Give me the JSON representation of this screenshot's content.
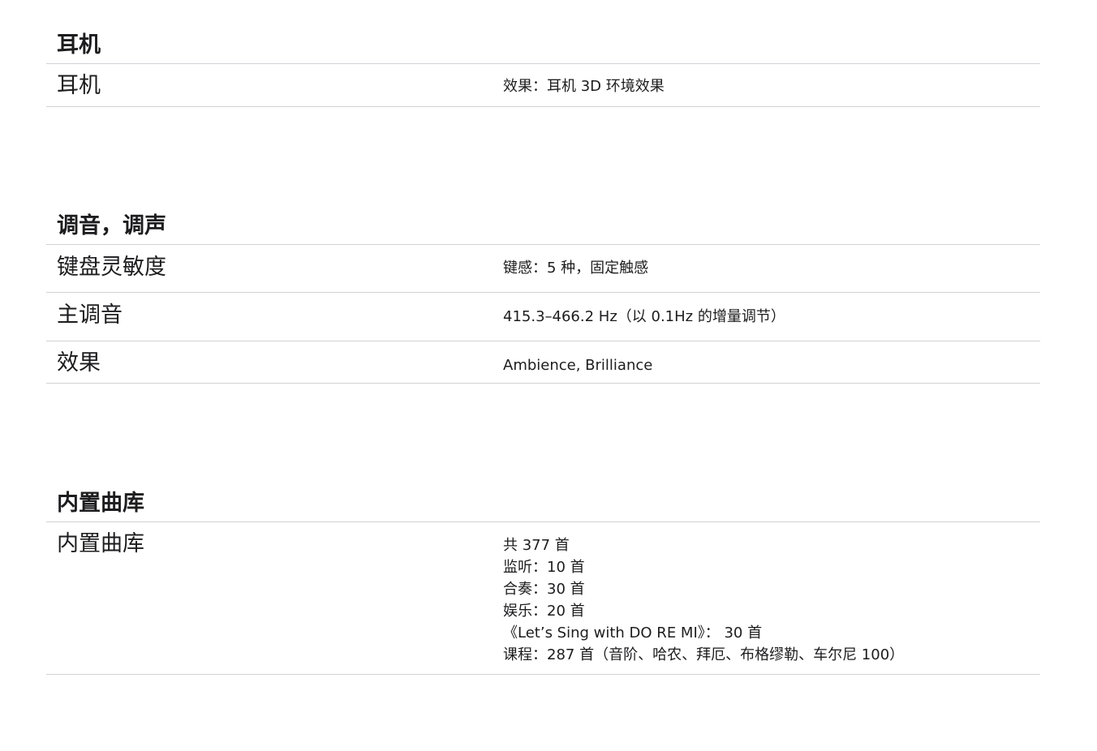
{
  "sections": [
    {
      "title": "耳机",
      "rows": [
        {
          "label": "耳机",
          "value_lines": [
            "效果：耳机 3D 环境效果"
          ]
        }
      ]
    },
    {
      "title": "调音，调声",
      "rows": [
        {
          "label": "键盘灵敏度",
          "value_lines": [
            "键感：5 种，固定触感"
          ]
        },
        {
          "label": "主调音",
          "value_lines": [
            "415.3–466.2 Hz（以 0.1Hz 的增量调节）"
          ]
        },
        {
          "label": "效果",
          "value_lines": [
            "Ambience, Brilliance"
          ]
        }
      ]
    },
    {
      "title": "内置曲库",
      "rows": [
        {
          "label": "内置曲库",
          "value_lines": [
            "共 377 首",
            "监听：10 首",
            "合奏：30 首",
            "娱乐：20 首",
            "《Let’s Sing with DO RE MI》：  30 首",
            "课程：287 首（音阶、哈农、拜厄、布格缪勒、车尔尼 100）"
          ]
        }
      ]
    }
  ]
}
